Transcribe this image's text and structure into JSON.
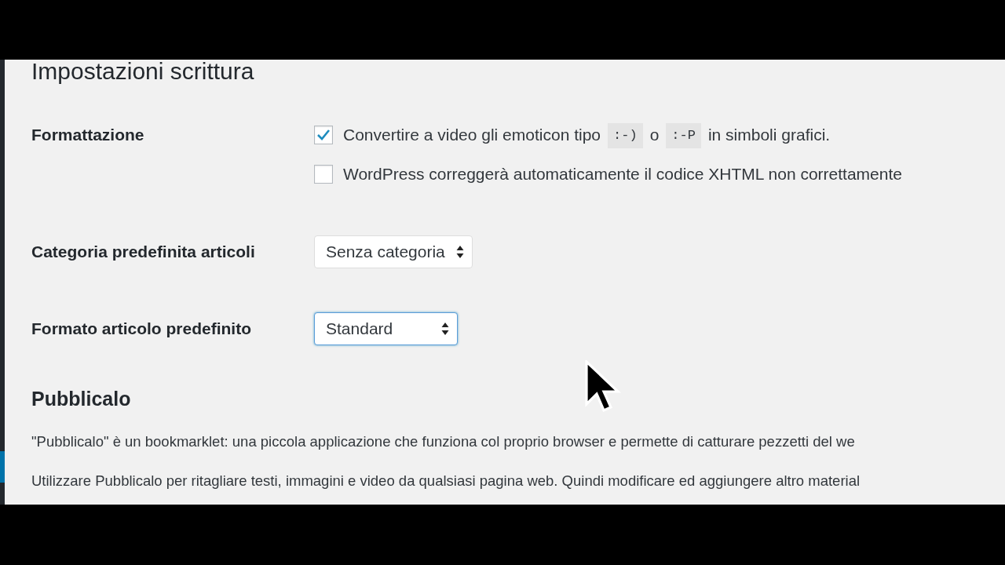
{
  "page": {
    "title": "Impostazioni scrittura"
  },
  "settings": [
    {
      "label": "Formattazione",
      "kind": "checkboxes",
      "options": [
        {
          "checked": true,
          "segments": [
            {
              "kind": "text",
              "text": "Convertire a video gli emoticon tipo"
            },
            {
              "kind": "code",
              "text": ":-)"
            },
            {
              "kind": "text",
              "text": "o"
            },
            {
              "kind": "code",
              "text": ":-P"
            },
            {
              "kind": "text",
              "text": "in simboli grafici."
            }
          ]
        },
        {
          "checked": false,
          "segments": [
            {
              "kind": "text",
              "text": "WordPress correggerà automaticamente il codice XHTML non correttamente"
            }
          ]
        }
      ]
    },
    {
      "label": "Categoria predefinita articoli",
      "kind": "select",
      "value": "Senza categoria",
      "focused": false
    },
    {
      "label": "Formato articolo predefinito",
      "kind": "select",
      "value": "Standard",
      "focused": true
    }
  ],
  "section": {
    "heading": "Pubblicalo",
    "paragraphs": [
      "\"Pubblicalo\" è un bookmarklet: una piccola applicazione che funziona col proprio browser e permette di catturare pezzetti del we",
      "Utilizzare Pubblicalo per ritagliare testi, immagini e video da qualsiasi pagina web. Quindi modificare ed aggiungere altro material"
    ]
  }
}
